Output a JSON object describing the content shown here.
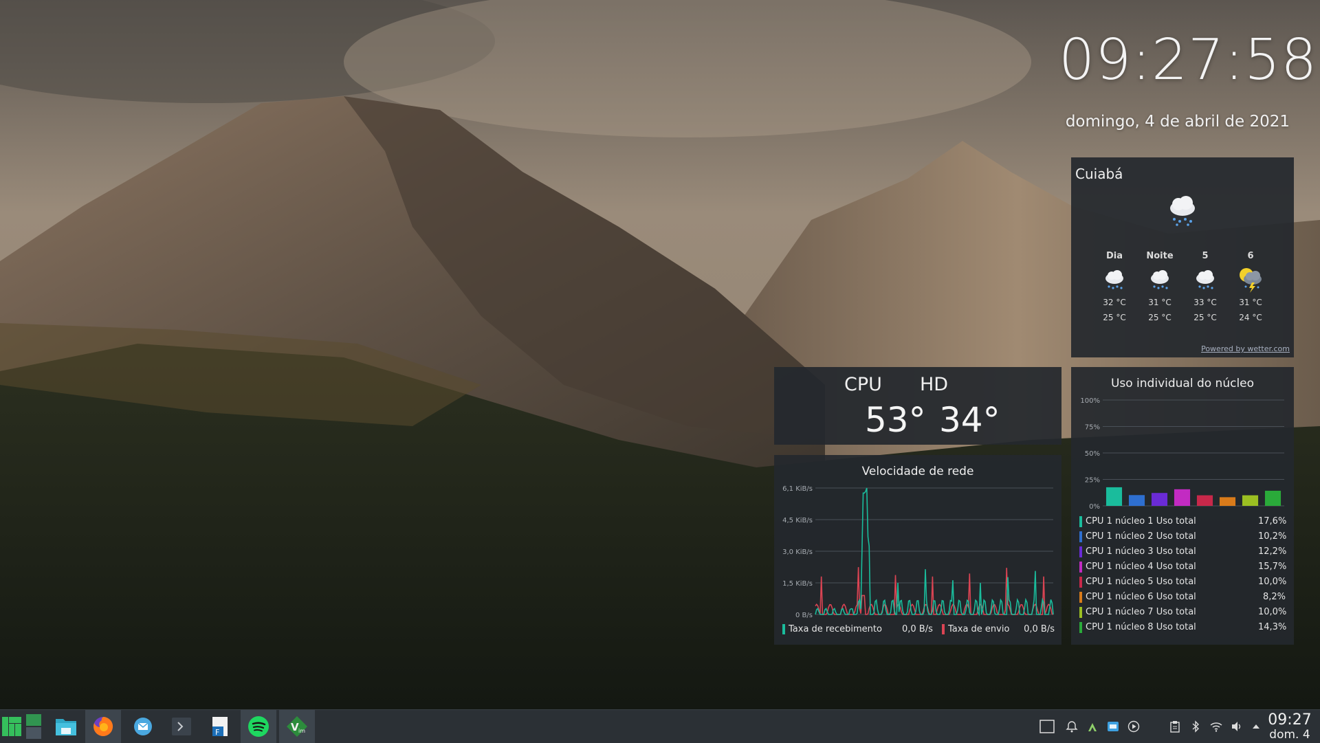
{
  "clock": {
    "time": "09:27:58",
    "date": "domingo, 4 de abril de 2021"
  },
  "weather": {
    "city": "Cuiabá",
    "current_icon": "cloud-rain-icon",
    "forecast": [
      {
        "label": "Dia",
        "icon": "cloud-rain-icon",
        "high": "32 °C",
        "low": "25 °C"
      },
      {
        "label": "Noite",
        "icon": "cloud-rain-icon",
        "high": "31 °C",
        "low": "25 °C"
      },
      {
        "label": "5",
        "icon": "cloud-rain-icon",
        "high": "33 °C",
        "low": "25 °C"
      },
      {
        "label": "6",
        "icon": "thunderstorm-icon",
        "high": "31 °C",
        "low": "24 °C"
      }
    ],
    "powered_by": "Powered by wetter.com"
  },
  "temps": {
    "cpu_label": "CPU",
    "hd_label": "HD",
    "cpu_value": "53°",
    "hd_value": "34°"
  },
  "network": {
    "title": "Velocidade de rede",
    "y_ticks": [
      "6,1 KiB/s",
      "4,5 KiB/s",
      "3,0 KiB/s",
      "1,5 KiB/s",
      "0 B/s"
    ],
    "receive_label": "Taxa de recebimento",
    "receive_value": "0,0 B/s",
    "send_label": "Taxa de envio",
    "send_value": "0,0 B/s",
    "receive_color": "#1abc9c",
    "send_color": "#da4453"
  },
  "cores": {
    "title": "Uso individual do núcleo",
    "y_ticks": [
      "100%",
      "75%",
      "50%",
      "25%",
      "0%"
    ],
    "items": [
      {
        "name": "CPU 1 núcleo 1 Uso total",
        "pct": "17,6%",
        "value": 17.6,
        "color": "#1abc9c"
      },
      {
        "name": "CPU 1 núcleo 2 Uso total",
        "pct": "10,2%",
        "value": 10.2,
        "color": "#2e6fd0"
      },
      {
        "name": "CPU 1 núcleo 3 Uso total",
        "pct": "12,2%",
        "value": 12.2,
        "color": "#6a2bd6"
      },
      {
        "name": "CPU 1 núcleo 4 Uso total",
        "pct": "15,7%",
        "value": 15.7,
        "color": "#c22bc2"
      },
      {
        "name": "CPU 1 núcleo 5 Uso total",
        "pct": "10,0%",
        "value": 10.0,
        "color": "#c8284a"
      },
      {
        "name": "CPU 1 núcleo 6 Uso total",
        "pct": "8,2%",
        "value": 8.2,
        "color": "#d97b1a"
      },
      {
        "name": "CPU 1 núcleo 7 Uso total",
        "pct": "10,0%",
        "value": 10.0,
        "color": "#9bbf22"
      },
      {
        "name": "CPU 1 núcleo 8 Uso total",
        "pct": "14,3%",
        "value": 14.3,
        "color": "#2aaa3a"
      }
    ]
  },
  "taskbar": {
    "apps": [
      "manjaro-menu-icon",
      "workspace-pager-icon",
      "file-manager-icon",
      "firefox-icon",
      "mail-icon",
      "terminal-icon",
      "office-writer-icon",
      "spotify-icon",
      "vim-icon"
    ],
    "tray": [
      "show-desktop-icon",
      "notifications-icon",
      "kdeconnect-icon",
      "updates-icon",
      "media-player-icon",
      "clipboard-icon",
      "bluetooth-icon",
      "wifi-icon",
      "volume-icon",
      "expand-tray-icon"
    ],
    "time": "09:27",
    "date": "dom. 4"
  }
}
